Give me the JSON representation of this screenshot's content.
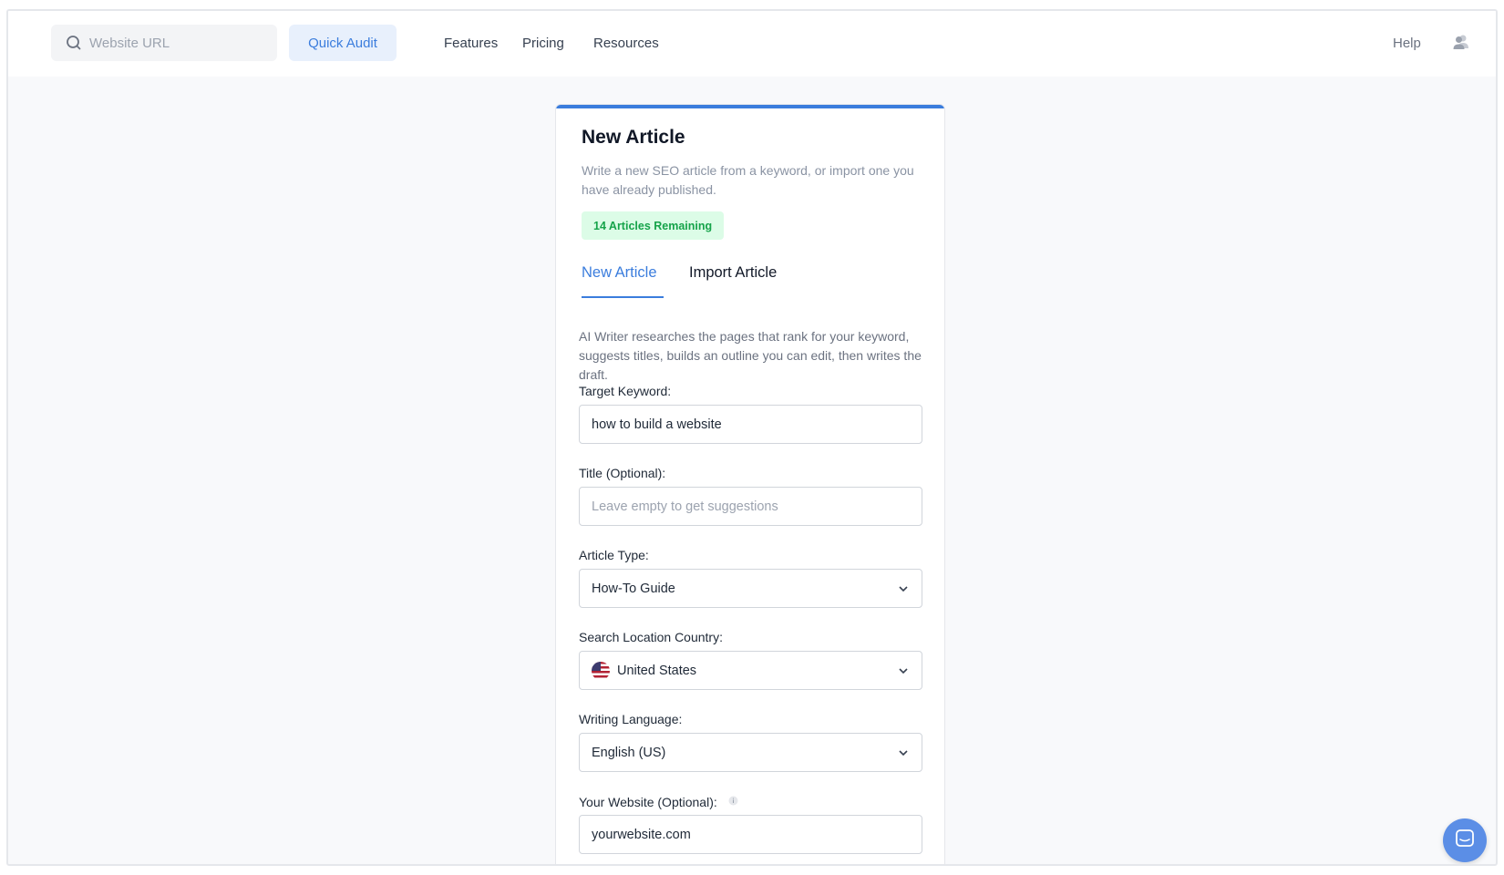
{
  "header": {
    "search": {
      "placeholder": "Website URL",
      "icon": "search-icon"
    },
    "quick_audit_label": "Quick Audit",
    "nav": [
      "Features",
      "Pricing",
      "Resources"
    ],
    "help_label": "Help",
    "user_icon": "users-icon"
  },
  "card": {
    "title": "New Article",
    "subtitle": "Write a new SEO article from a keyword, or import one you have already published.",
    "badge": "14 Articles Remaining",
    "tabs": [
      {
        "label": "New Article",
        "active": true
      },
      {
        "label": "Import Article",
        "active": false
      }
    ],
    "description": "AI Writer researches the pages that rank for your keyword, suggests titles, builds an outline you can edit, then writes the draft.",
    "fields": {
      "keyword": {
        "label": "Target Keyword:",
        "value": "how to build a website"
      },
      "title": {
        "label": "Title (Optional):",
        "placeholder": "Leave empty to get suggestions"
      },
      "article_type": {
        "label": "Article Type:",
        "value": "How-To Guide"
      },
      "country": {
        "label": "Search Location Country:",
        "value": "United States",
        "icon": "us-flag-icon"
      },
      "language": {
        "label": "Writing Language:",
        "value": "English (US)"
      },
      "website": {
        "label": "Your Website (Optional):",
        "value": "yourwebsite.com",
        "icon": "info-icon"
      }
    }
  },
  "chat_widget": {
    "icon": "chat-icon"
  },
  "colors": {
    "accent": "#3b7ddd",
    "badge_bg": "#dcfce7",
    "badge_text": "#16a34a",
    "page_bg": "#f8f9fb"
  }
}
